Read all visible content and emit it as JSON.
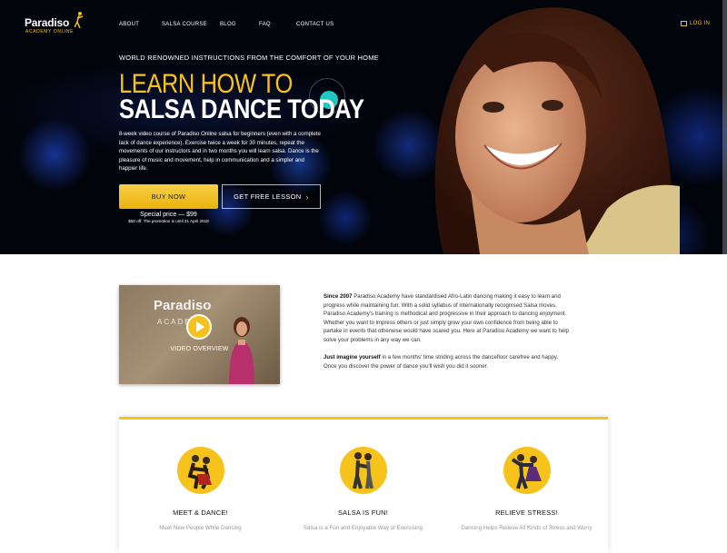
{
  "brand": {
    "name": "Paradiso",
    "sub": "ACADEMY ONLINE"
  },
  "nav": {
    "items": [
      "ABOUT",
      "SALSA COURSE",
      "BLOG",
      "FAQ",
      "CONTACT US"
    ],
    "login": "LOG IN"
  },
  "hero": {
    "tagline": "WORLD RENOWNED INSTRUCTIONS FROM THE COMFORT OF YOUR HOME",
    "headline_1": "LEARN HOW TO",
    "headline_2": "SALSA DANCE TODAY",
    "description": "8-week video course of Paradiso Online salsa for beginners (even with a complete lack of dance experience). Exercise twice a week for 30 minutes, repeat the movements of our instructors and in two months you will learn salsa. Dance is the pleasure of music and movement, help in communication and a simpler and happier life.",
    "buy_label": "BUY NOW",
    "free_label": "GET FREE LESSON",
    "price": "Special price — $99",
    "promo": "$50 off. The promotion is until 31 April 2019"
  },
  "video": {
    "brand": "Paradiso",
    "brand_sub": "ACADEMY",
    "label": "VIDEO OVERVIEW"
  },
  "about": {
    "p1_lead": "Since 2007",
    "p1_rest": " Paradiso Academy have standardised Afro-Latin dancing making it easy to learn and progress while maintaining fun.  With a solid syllabus of internationally recognised Salsa moves, Paradiso Academy's training is methodical and progressive in their approach to dancing enjoyment. Whether you want to impress others or just simply grow your own confidence from being able to partake in events that otherwise would have scared you. Here at Paradiso Academy we want to help solve your problems in any way we can.",
    "p2_lead": "Just imagine yourself",
    "p2_rest": " in a few months' time striding across the dancefloor carefree and happy. Once you discover the power of dance you'll wish you did it sooner."
  },
  "features": [
    {
      "title": "MEET & DANCE!",
      "subtitle": "Meet New People While Dancing",
      "icon": "couple-dance-icon"
    },
    {
      "title": "SALSA IS FUN!",
      "subtitle": "Salsa is a Fun and Enjoyable Way of Exercising",
      "icon": "salsa-couple-icon"
    },
    {
      "title": "RELIEVE STRESS!",
      "subtitle": "Dancing Helps Relieve All Kinds of Stress and Worry",
      "icon": "spin-couple-icon"
    }
  ],
  "colors": {
    "accent": "#f6c21c",
    "teal": "#1fc7c0",
    "hero_bg": "#02040c"
  }
}
